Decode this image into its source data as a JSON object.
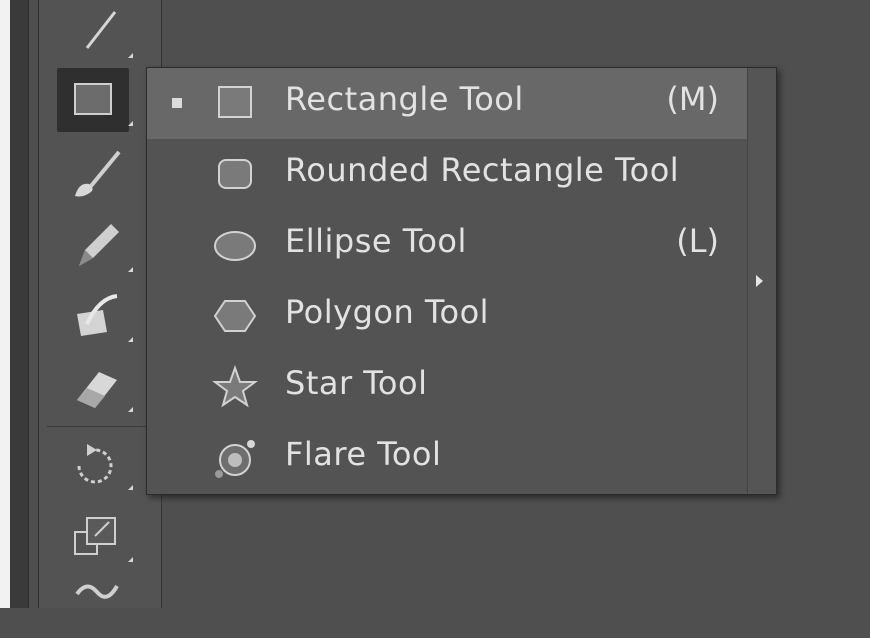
{
  "flyout": {
    "items": [
      {
        "label": "Rectangle Tool",
        "shortcut": "(M)",
        "icon": "rectangle-icon",
        "selected": true
      },
      {
        "label": "Rounded Rectangle Tool",
        "shortcut": "",
        "icon": "rounded-rectangle-icon",
        "selected": false
      },
      {
        "label": "Ellipse Tool",
        "shortcut": "(L)",
        "icon": "ellipse-icon",
        "selected": false
      },
      {
        "label": "Polygon Tool",
        "shortcut": "",
        "icon": "polygon-icon",
        "selected": false
      },
      {
        "label": "Star Tool",
        "shortcut": "",
        "icon": "star-icon",
        "selected": false
      },
      {
        "label": "Flare Tool",
        "shortcut": "",
        "icon": "flare-icon",
        "selected": false
      }
    ],
    "tearoff_icon": "tearoff-arrow-icon"
  },
  "toolbar": {
    "tools": [
      "line-segment-icon",
      "rectangle-icon",
      "paintbrush-icon",
      "pencil-icon",
      "shaper-icon",
      "eraser-icon",
      "rotate-icon",
      "scale-icon",
      "width-icon"
    ]
  },
  "colors": {
    "panel": "#535353",
    "canvas": "#4f4f4f",
    "selected_row": "#686868",
    "text": "#e2e2e2"
  }
}
